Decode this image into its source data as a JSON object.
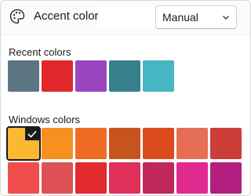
{
  "header": {
    "label": "Accent color",
    "icon": "palette-icon",
    "dropdown": {
      "value": "Manual",
      "icon": "chevron-down-icon"
    }
  },
  "recent": {
    "title": "Recent colors",
    "colors": [
      "#5d7483",
      "#e0282b",
      "#9a46bf",
      "#367f8d",
      "#46b6c4"
    ]
  },
  "windows": {
    "title": "Windows colors",
    "selected_index": 0,
    "rows": [
      [
        "#fbb830",
        "#f7901e",
        "#ef6b25",
        "#c7541e",
        "#db4b1d",
        "#e66e55",
        "#cc3d38"
      ],
      [
        "#ef4c4c",
        "#de5257",
        "#e22a2f",
        "#e0305a",
        "#c0275a",
        "#e02a90",
        "#b21f7e"
      ]
    ]
  }
}
